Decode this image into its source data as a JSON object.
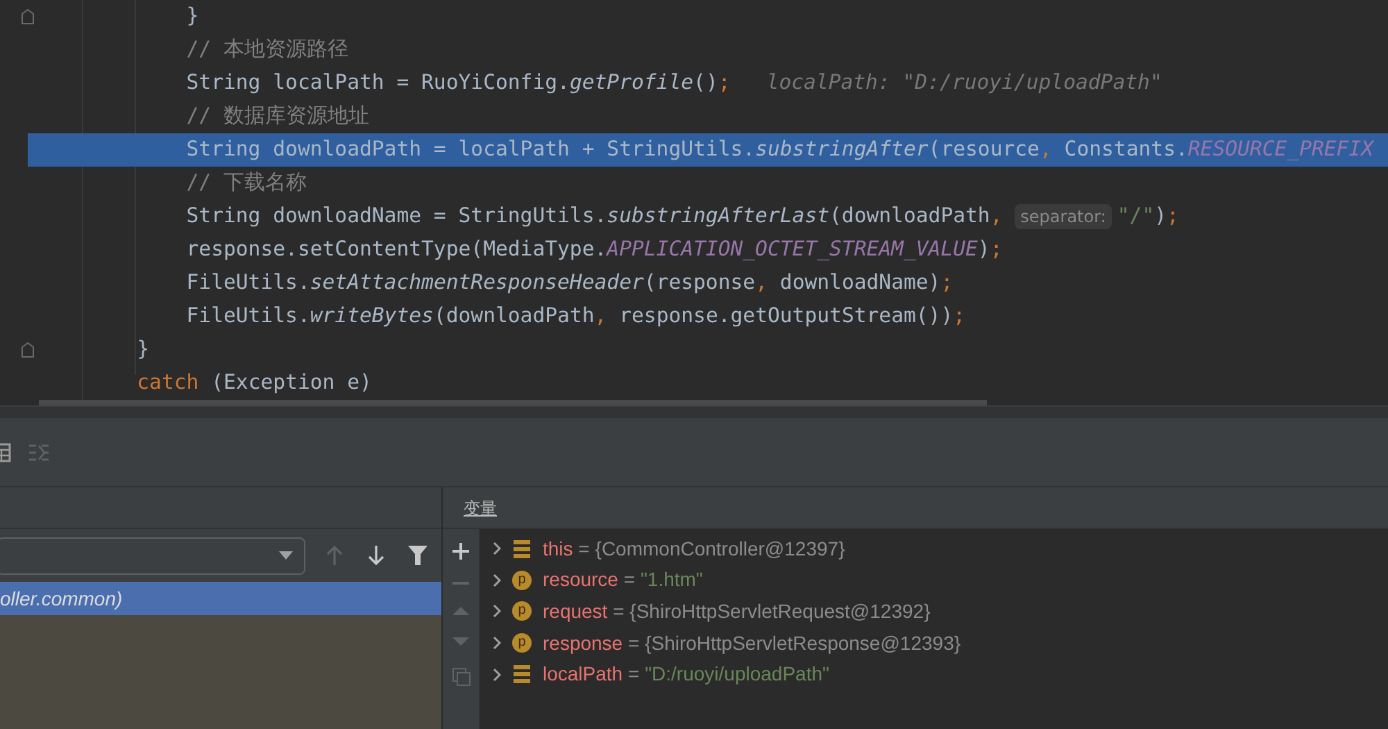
{
  "editor": {
    "lines": [
      {
        "highlighted": false,
        "fold": true,
        "tokens": [
          {
            "kind": "plain",
            "text": "        }"
          }
        ]
      },
      {
        "highlighted": false,
        "fold": false,
        "tokens": [
          {
            "kind": "comment",
            "text": "        // 本地资源路径"
          }
        ]
      },
      {
        "highlighted": false,
        "fold": false,
        "tokens": [
          {
            "kind": "plain",
            "text": "        String localPath = RuoYiConfig."
          },
          {
            "kind": "method",
            "text": "getProfile"
          },
          {
            "kind": "plain",
            "text": "()"
          },
          {
            "kind": "punct",
            "text": ";"
          },
          {
            "kind": "hint",
            "text": "localPath: \"D:/ruoyi/uploadPath\""
          }
        ]
      },
      {
        "highlighted": false,
        "fold": false,
        "tokens": [
          {
            "kind": "comment",
            "text": "        // 数据库资源地址"
          }
        ]
      },
      {
        "highlighted": true,
        "fold": false,
        "tokens": [
          {
            "kind": "plain",
            "text": "        String downloadPath = localPath + StringUtils."
          },
          {
            "kind": "method",
            "text": "substringAfter"
          },
          {
            "kind": "plain",
            "text": "(resource"
          },
          {
            "kind": "punct",
            "text": ", "
          },
          {
            "kind": "plain",
            "text": "Constants."
          },
          {
            "kind": "constant",
            "text": "RESOURCE_PREFIX"
          }
        ]
      },
      {
        "highlighted": false,
        "fold": false,
        "tokens": [
          {
            "kind": "comment",
            "text": "        // 下载名称"
          }
        ]
      },
      {
        "highlighted": false,
        "fold": false,
        "tokens": [
          {
            "kind": "plain",
            "text": "        String downloadName = StringUtils."
          },
          {
            "kind": "method",
            "text": "substringAfterLast"
          },
          {
            "kind": "plain",
            "text": "(downloadPath"
          },
          {
            "kind": "punct",
            "text": ", "
          },
          {
            "kind": "param_hint",
            "text": "separator:"
          },
          {
            "kind": "string",
            "text": "\"/\""
          },
          {
            "kind": "plain",
            "text": ")"
          },
          {
            "kind": "punct",
            "text": ";"
          }
        ]
      },
      {
        "highlighted": false,
        "fold": false,
        "tokens": [
          {
            "kind": "plain",
            "text": "        response.setContentType(MediaType."
          },
          {
            "kind": "constant",
            "text": "APPLICATION_OCTET_STREAM_VALUE"
          },
          {
            "kind": "plain",
            "text": ")"
          },
          {
            "kind": "punct",
            "text": ";"
          }
        ]
      },
      {
        "highlighted": false,
        "fold": false,
        "tokens": [
          {
            "kind": "plain",
            "text": "        FileUtils."
          },
          {
            "kind": "method",
            "text": "setAttachmentResponseHeader"
          },
          {
            "kind": "plain",
            "text": "(response"
          },
          {
            "kind": "punct",
            "text": ", "
          },
          {
            "kind": "plain",
            "text": "downloadName)"
          },
          {
            "kind": "punct",
            "text": ";"
          }
        ]
      },
      {
        "highlighted": false,
        "fold": false,
        "tokens": [
          {
            "kind": "plain",
            "text": "        FileUtils."
          },
          {
            "kind": "method",
            "text": "writeBytes"
          },
          {
            "kind": "plain",
            "text": "(downloadPath"
          },
          {
            "kind": "punct",
            "text": ", "
          },
          {
            "kind": "plain",
            "text": "response.getOutputStream())"
          },
          {
            "kind": "punct",
            "text": ";"
          }
        ]
      },
      {
        "highlighted": false,
        "fold": true,
        "tokens": [
          {
            "kind": "plain",
            "text": "    }"
          }
        ]
      },
      {
        "highlighted": false,
        "fold": false,
        "tokens": [
          {
            "kind": "keyword",
            "text": "    catch "
          },
          {
            "kind": "plain",
            "text": "(Exception e)"
          }
        ]
      }
    ]
  },
  "frames": {
    "rows": [
      {
        "text": "oller.common)",
        "selected": true
      }
    ]
  },
  "variables": {
    "title": "变量",
    "items": [
      {
        "kind": "field",
        "name": "this",
        "operator": "=",
        "value": {
          "kind": "object",
          "text": "{CommonController@12397}"
        }
      },
      {
        "kind": "param",
        "badge": "p",
        "name": "resource",
        "operator": "=",
        "value": {
          "kind": "string",
          "text": "\"1.htm\""
        }
      },
      {
        "kind": "param",
        "badge": "p",
        "name": "request",
        "operator": "=",
        "value": {
          "kind": "object",
          "text": "{ShiroHttpServletRequest@12392}"
        }
      },
      {
        "kind": "param",
        "badge": "p",
        "name": "response",
        "operator": "=",
        "value": {
          "kind": "object",
          "text": "{ShiroHttpServletResponse@12393}"
        }
      },
      {
        "kind": "field",
        "name": "localPath",
        "operator": "=",
        "value": {
          "kind": "string",
          "text": "\"D:/ruoyi/uploadPath\""
        }
      }
    ]
  }
}
